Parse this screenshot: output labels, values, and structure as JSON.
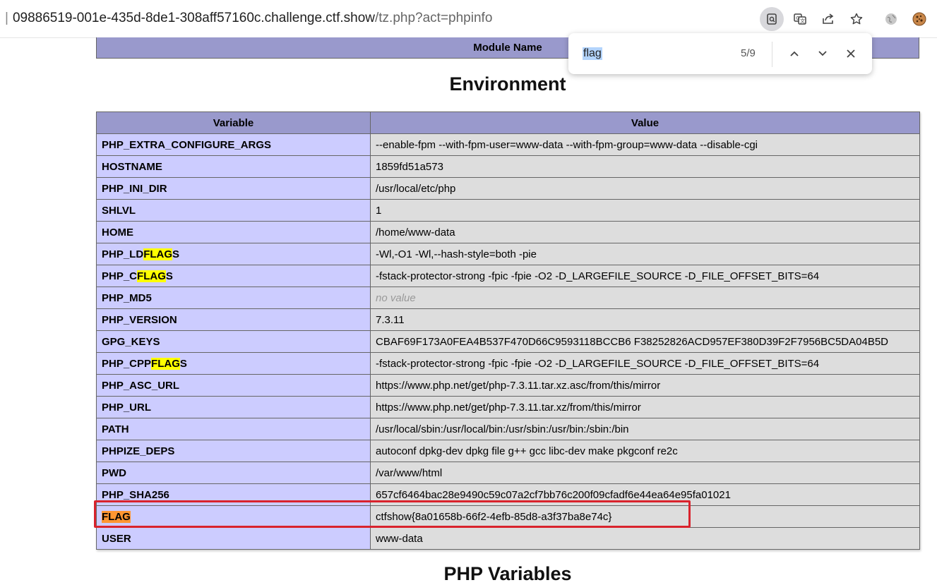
{
  "browser": {
    "url_host": "09886519-001e-435d-8de1-308aff57160c.challenge.ctf.show",
    "url_path": "/tz.php?act=phpinfo",
    "toolbar_icons": [
      "find-in-page-icon",
      "translate-icon",
      "share-icon",
      "bookmark-star-icon",
      "extension-globe-icon",
      "cookie-extension-icon"
    ]
  },
  "findbar": {
    "query": "flag",
    "count": "5/9"
  },
  "page": {
    "module_header": "Module Name",
    "section_title": "Environment",
    "next_section_title": "PHP Variables",
    "table": {
      "headers": [
        "Variable",
        "Value"
      ],
      "rows": [
        {
          "name": "PHP_EXTRA_CONFIGURE_ARGS",
          "value": "--enable-fpm --with-fpm-user=www-data --with-fpm-group=www-data --disable-cgi"
        },
        {
          "name": "HOSTNAME",
          "value": "1859fd51a573"
        },
        {
          "name": "PHP_INI_DIR",
          "value": "/usr/local/etc/php"
        },
        {
          "name": "SHLVL",
          "value": "1"
        },
        {
          "name": "HOME",
          "value": "/home/www-data"
        },
        {
          "name_pre": "PHP_LD",
          "name_match": "FLAG",
          "name_post": "S",
          "value": "-Wl,-O1 -Wl,--hash-style=both -pie"
        },
        {
          "name_pre": "PHP_C",
          "name_match": "FLAG",
          "name_post": "S",
          "value": "-fstack-protector-strong -fpic -fpie -O2 -D_LARGEFILE_SOURCE -D_FILE_OFFSET_BITS=64"
        },
        {
          "name": "PHP_MD5",
          "value": "no value"
        },
        {
          "name": "PHP_VERSION",
          "value": "7.3.11"
        },
        {
          "name": "GPG_KEYS",
          "value": "CBAF69F173A0FEA4B537F470D66C9593118BCCB6 F38252826ACD957EF380D39F2F7956BC5DA04B5D"
        },
        {
          "name_pre": "PHP_CPP",
          "name_match": "FLAG",
          "name_post": "S",
          "value": "-fstack-protector-strong -fpic -fpie -O2 -D_LARGEFILE_SOURCE -D_FILE_OFFSET_BITS=64"
        },
        {
          "name": "PHP_ASC_URL",
          "value": "https://www.php.net/get/php-7.3.11.tar.xz.asc/from/this/mirror"
        },
        {
          "name": "PHP_URL",
          "value": "https://www.php.net/get/php-7.3.11.tar.xz/from/this/mirror"
        },
        {
          "name": "PATH",
          "value": "/usr/local/sbin:/usr/local/bin:/usr/sbin:/usr/bin:/sbin:/bin"
        },
        {
          "name": "PHPIZE_DEPS",
          "value": "autoconf dpkg-dev dpkg file g++ gcc libc-dev make pkgconf re2c"
        },
        {
          "name": "PWD",
          "value": "/var/www/html"
        },
        {
          "name": "PHP_SHA256",
          "value": "657cf6464bac28e9490c59c07a2cf7bb76c200f09cfadf6e44ea64e95fa01021"
        },
        {
          "name_current": "FLAG",
          "value": "ctfshow{8a01658b-66f2-4efb-85d8-a3f37ba8e74c}"
        },
        {
          "name": "USER",
          "value": "www-data"
        }
      ]
    }
  },
  "colors": {
    "header_bg": "#9999cc",
    "name_cell_bg": "#ccccff",
    "value_cell_bg": "#dddddd",
    "find_highlight": "#ffff00",
    "find_current_highlight": "#ff9632",
    "annotation_box": "#d9232d"
  }
}
